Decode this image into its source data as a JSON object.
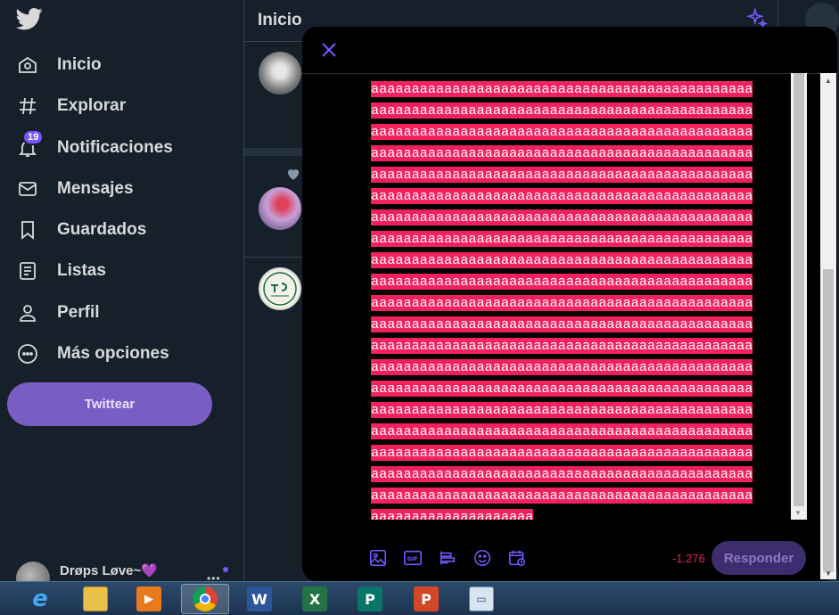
{
  "nav": {
    "items": [
      {
        "label": "Inicio",
        "icon": "home-icon"
      },
      {
        "label": "Explorar",
        "icon": "hashtag-icon"
      },
      {
        "label": "Notificaciones",
        "icon": "bell-icon",
        "badge": "19"
      },
      {
        "label": "Mensajes",
        "icon": "envelope-icon"
      },
      {
        "label": "Guardados",
        "icon": "bookmark-icon"
      },
      {
        "label": "Listas",
        "icon": "list-icon"
      },
      {
        "label": "Perfil",
        "icon": "person-icon"
      },
      {
        "label": "Más opciones",
        "icon": "more-circle-icon"
      }
    ],
    "tweet_button": "Twittear",
    "account_name": "Drøps Løve~💜"
  },
  "timeline": {
    "title": "Inicio"
  },
  "compose": {
    "text_full_line": "aaaaaaaaaaaaaaaaaaaaaaaaaaaaaaaaaaaaaaaaaaaaaaa",
    "text_last_line": "aaaaaaaaaaaaaaaaaaaa",
    "full_line_count": 20,
    "char_counter": "-1.276",
    "reply_button": "Responder",
    "toolbar": [
      "image-icon",
      "gif-icon",
      "poll-icon",
      "emoji-icon",
      "schedule-icon"
    ]
  },
  "taskbar": {
    "apps": [
      "internet-explorer",
      "file-explorer",
      "media-player",
      "chrome",
      "word",
      "excel",
      "publisher",
      "powerpoint",
      "remote-desktop"
    ]
  },
  "colors": {
    "accent": "#7856ff",
    "overflow_highlight": "#f4215f",
    "counter_over": "#e0245e",
    "background": "#15202b"
  }
}
